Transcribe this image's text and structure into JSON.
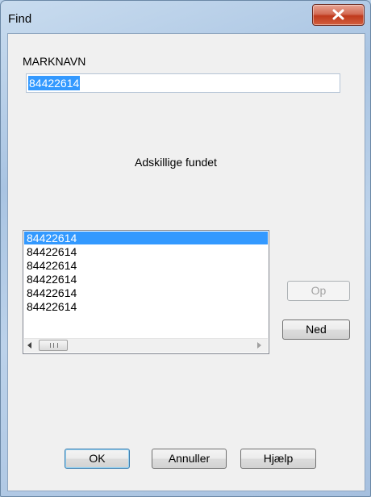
{
  "window": {
    "title": "Find"
  },
  "form": {
    "field_label": "MARKNAVN",
    "field_value": "84422614",
    "status_text": "Adskillige fundet"
  },
  "results": {
    "items": [
      "84422614",
      "84422614",
      "84422614",
      "84422614",
      "84422614",
      "84422614"
    ],
    "selected_index": 0
  },
  "buttons": {
    "up": "Op",
    "down": "Ned",
    "ok": "OK",
    "cancel": "Annuller",
    "help": "Hjælp"
  },
  "colors": {
    "selection": "#3399ff",
    "close_button": "#c03a1d"
  },
  "icons": {
    "close": "close-x-icon",
    "scroll_left": "arrow-left-icon",
    "scroll_right": "arrow-right-icon",
    "scroll_grip": "grip-icon"
  }
}
